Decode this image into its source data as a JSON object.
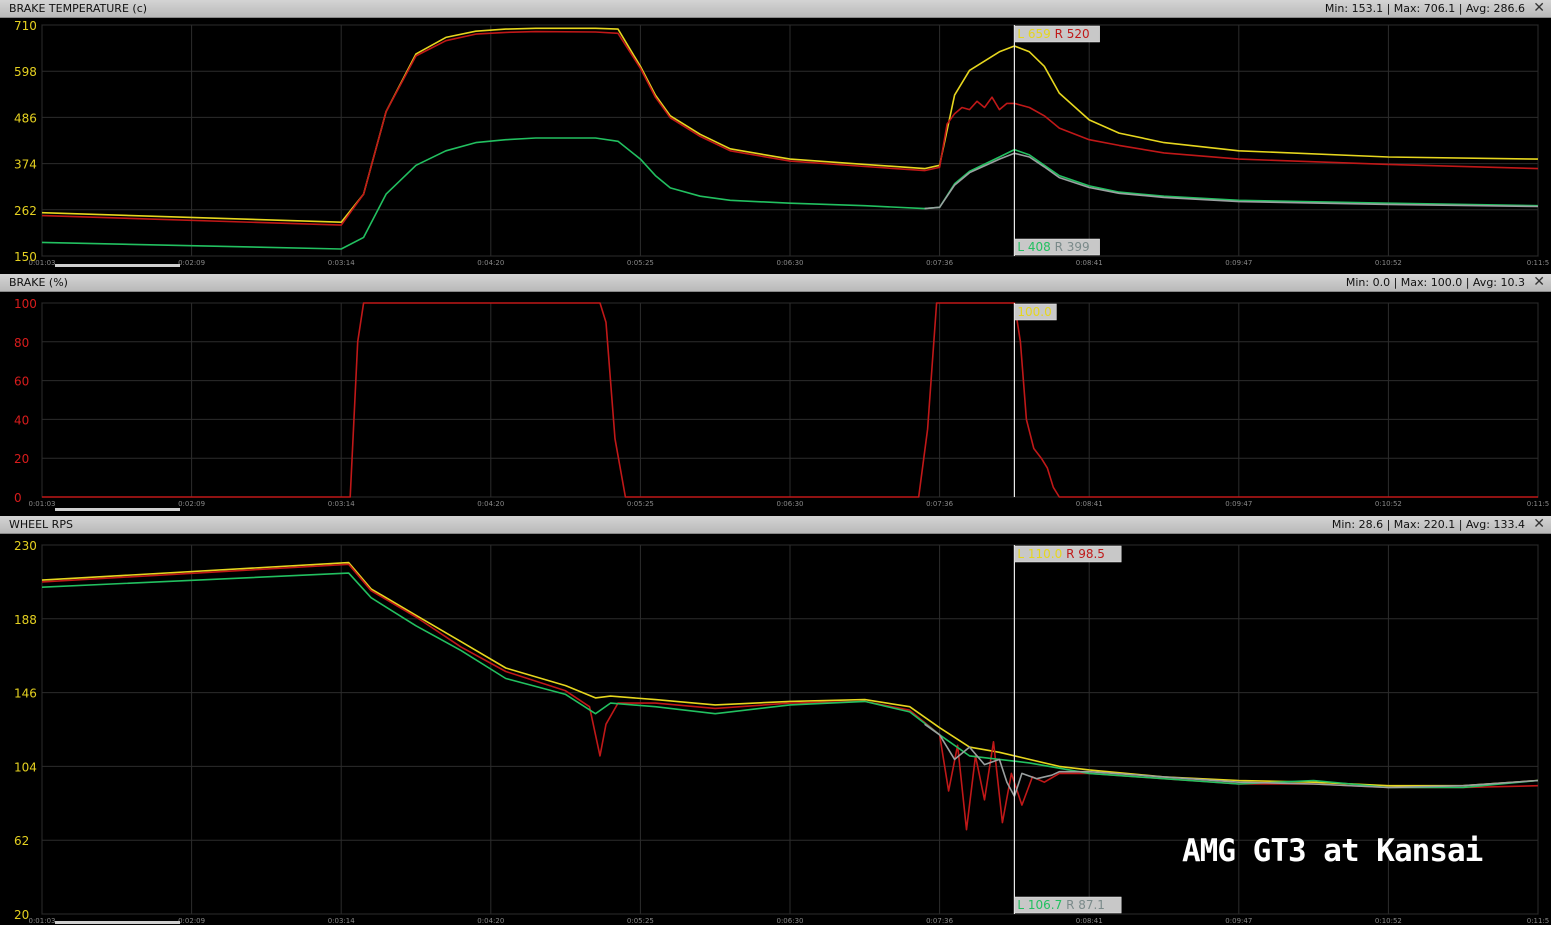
{
  "caption": "AMG GT3 at Kansai",
  "colors": {
    "yellow": "#e6d61e",
    "red": "#c01818",
    "green": "#22c060",
    "gray": "#9aa0a0",
    "tick_yellow": "#e4d020",
    "tick_red": "#d81c1c"
  },
  "x_tick_labels": [
    "0:01:03",
    "0:02:09",
    "0:03:14",
    "0:04:20",
    "0:05:25",
    "0:06:30",
    "0:07:36",
    "0:08:41",
    "0:09:47",
    "0:10:52",
    "0:11:5"
  ],
  "panels": [
    {
      "id": "brake-temp",
      "title": "BRAKE TEMPERATURE (c)",
      "stats": "Min: 153.1 | Max: 706.1 | Avg: 286.6"
    },
    {
      "id": "brake",
      "title": "BRAKE (%)",
      "stats": "Min: 0.0 | Max: 100.0 | Avg: 10.3"
    },
    {
      "id": "wheel-rps",
      "title": "WHEEL RPS",
      "stats": "Min: 28.6 | Max: 220.1 | Avg: 133.4"
    }
  ],
  "chart_data": [
    {
      "type": "line",
      "title": "BRAKE TEMPERATURE (c)",
      "ylim": [
        150,
        710
      ],
      "y_ticks": [
        "710",
        "598",
        "486",
        "374",
        "262",
        "150"
      ],
      "xlim": [
        0,
        100
      ],
      "cursor_x": 65,
      "cursor_top_label": {
        "left": "L 659",
        "right": "R 520"
      },
      "cursor_bottom_label": {
        "left": "L 408",
        "right": "R 399"
      },
      "series": [
        {
          "color": "yellow",
          "x": [
            0,
            20,
            21.5,
            23,
            25,
            27,
            29,
            31,
            33,
            37,
            38.5,
            40,
            41,
            42,
            44,
            46,
            50,
            55,
            59,
            60,
            61,
            62,
            64,
            65,
            66,
            67,
            68,
            70,
            72,
            75,
            80,
            90,
            100
          ],
          "y": [
            255,
            232,
            300,
            500,
            640,
            680,
            695,
            700,
            702,
            702,
            700,
            610,
            540,
            490,
            445,
            410,
            385,
            372,
            362,
            370,
            540,
            600,
            645,
            659,
            645,
            610,
            545,
            480,
            448,
            425,
            405,
            390,
            385
          ]
        },
        {
          "color": "red",
          "x": [
            0,
            20,
            21.5,
            23,
            25,
            27,
            29,
            31,
            33,
            37,
            38.5,
            40,
            41,
            42,
            44,
            46,
            50,
            55,
            59,
            60,
            60.5,
            61,
            61.5,
            62,
            62.5,
            63,
            63.5,
            64,
            64.5,
            65,
            66,
            67,
            68,
            70,
            72,
            75,
            80,
            90,
            100
          ],
          "y": [
            248,
            225,
            300,
            500,
            635,
            672,
            688,
            692,
            694,
            693,
            690,
            605,
            535,
            485,
            440,
            405,
            380,
            367,
            357,
            365,
            470,
            495,
            510,
            505,
            525,
            510,
            535,
            505,
            520,
            520,
            510,
            490,
            460,
            432,
            418,
            400,
            385,
            372,
            362
          ]
        },
        {
          "color": "green",
          "x": [
            0,
            20,
            21.5,
            23,
            25,
            27,
            29,
            31,
            33,
            37,
            38.5,
            40,
            41,
            42,
            44,
            46,
            50,
            55,
            59,
            60,
            61,
            62,
            64,
            65,
            66,
            67,
            68,
            70,
            72,
            75,
            80,
            90,
            100
          ],
          "y": [
            183,
            167,
            195,
            300,
            370,
            405,
            425,
            432,
            436,
            436,
            428,
            385,
            345,
            315,
            295,
            285,
            278,
            272,
            265,
            268,
            325,
            355,
            390,
            408,
            395,
            370,
            345,
            320,
            305,
            295,
            285,
            278,
            272
          ]
        },
        {
          "color": "gray",
          "x": [
            59,
            60,
            61,
            62,
            64,
            65,
            66,
            67,
            68,
            70,
            72,
            75,
            80,
            90,
            100
          ],
          "y": [
            265,
            268,
            322,
            352,
            385,
            399,
            390,
            366,
            340,
            316,
            302,
            292,
            282,
            275,
            270
          ]
        }
      ]
    },
    {
      "type": "line",
      "title": "BRAKE (%)",
      "ylim": [
        0,
        100
      ],
      "y_ticks": [
        "100",
        "80",
        "60",
        "40",
        "20",
        "0"
      ],
      "xlim": [
        0,
        100
      ],
      "cursor_x": 65,
      "cursor_top_label": {
        "value": "100.0"
      },
      "series": [
        {
          "color": "red",
          "x": [
            0,
            20.6,
            21.1,
            21.5,
            37.3,
            37.7,
            38.3,
            39.0,
            58.6,
            59.2,
            59.8,
            65,
            65.4,
            65.8,
            66.3,
            66.8,
            67.2,
            67.6,
            68.0,
            100
          ],
          "y": [
            0,
            0,
            80,
            100,
            100,
            90,
            30,
            0,
            0,
            35,
            100,
            100,
            80,
            40,
            25,
            20,
            15,
            5,
            0,
            0
          ]
        }
      ]
    },
    {
      "type": "line",
      "title": "WHEEL RPS",
      "ylim": [
        20,
        230
      ],
      "y_ticks": [
        "230",
        "188",
        "146",
        "104",
        "62",
        "20"
      ],
      "xlim": [
        0,
        100
      ],
      "cursor_x": 65,
      "cursor_top_label": {
        "left": "L 110.0",
        "right": "R 98.5"
      },
      "cursor_bottom_label": {
        "left": "L 106.7",
        "right": "R 87.1"
      },
      "series": [
        {
          "color": "yellow",
          "x": [
            0,
            20.5,
            22,
            25,
            28,
            31,
            35,
            37,
            38,
            41,
            45,
            50,
            55,
            58,
            60,
            62,
            64,
            66,
            68,
            70,
            75,
            80,
            85,
            90,
            95,
            100
          ],
          "y": [
            210,
            220,
            205,
            190,
            175,
            160,
            150,
            143,
            144,
            142,
            139,
            141,
            142,
            138,
            126,
            115,
            112,
            108,
            104,
            102,
            98,
            96,
            95,
            93,
            93,
            96
          ]
        },
        {
          "color": "red",
          "x": [
            0,
            20.5,
            22,
            25,
            28,
            31,
            35,
            36.6,
            37.3,
            37.7,
            38.5,
            41,
            45,
            50,
            55,
            58,
            60,
            60.6,
            61.2,
            61.8,
            62.4,
            63,
            63.6,
            64.2,
            64.8,
            65.5,
            66.2,
            67,
            68,
            70,
            75,
            80,
            85,
            90,
            95,
            100
          ],
          "y": [
            209,
            219,
            204,
            189,
            172,
            158,
            147,
            138,
            110,
            128,
            140,
            140,
            137,
            140,
            141,
            136,
            122,
            90,
            116,
            68,
            110,
            85,
            118,
            72,
            100,
            82,
            98,
            95,
            100,
            100,
            97,
            94,
            94,
            92,
            92,
            93
          ]
        },
        {
          "color": "green",
          "x": [
            0,
            20.5,
            22,
            25,
            28,
            31,
            35,
            37,
            38,
            41,
            45,
            50,
            55,
            58,
            60,
            62,
            64,
            66,
            68,
            70,
            75,
            80,
            85,
            90,
            95,
            100
          ],
          "y": [
            206,
            214,
            200,
            184,
            170,
            154,
            145,
            134,
            140,
            138,
            134,
            139,
            141,
            135,
            122,
            110,
            108,
            106,
            103,
            100,
            97,
            94,
            96,
            92,
            92,
            96
          ]
        },
        {
          "color": "gray",
          "x": [
            59,
            60,
            61,
            62,
            63,
            64,
            64.5,
            65,
            65.5,
            66.5,
            67.5,
            68,
            70,
            75,
            80,
            85,
            90,
            95,
            100
          ],
          "y": [
            128,
            122,
            108,
            115,
            105,
            108,
            95,
            87,
            100,
            97,
            99,
            101,
            101,
            98,
            95,
            94,
            92,
            93,
            96
          ]
        }
      ]
    }
  ]
}
